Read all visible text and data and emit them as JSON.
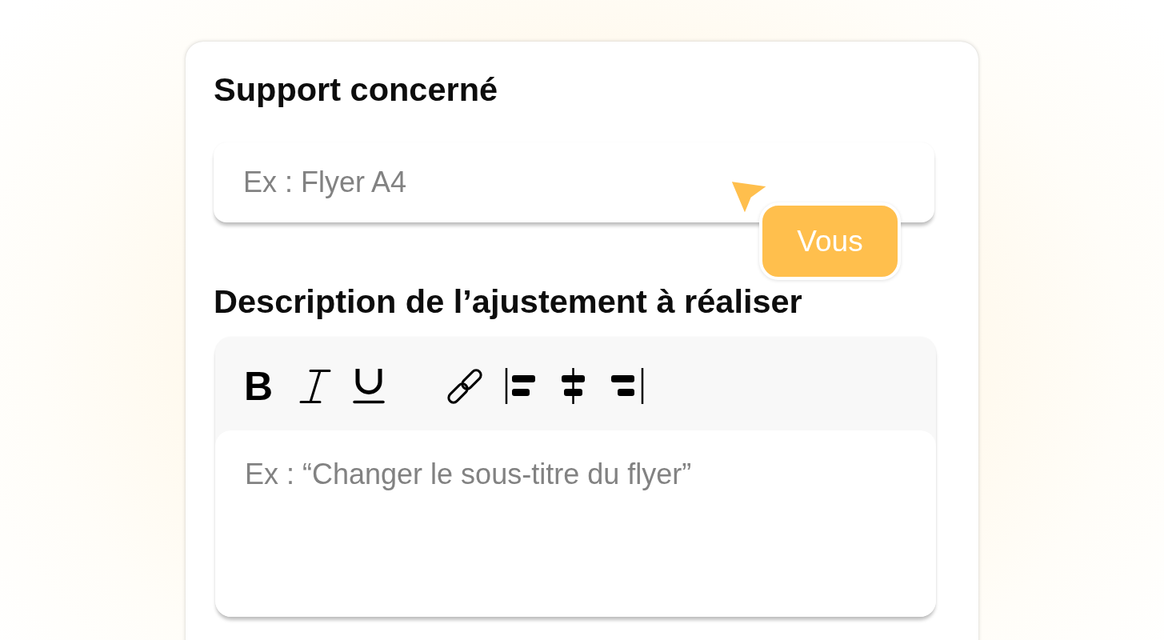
{
  "support_field": {
    "label": "Support concerné",
    "placeholder": "Ex : Flyer A4"
  },
  "cursor": {
    "label": "Vous"
  },
  "description_field": {
    "label": "Description de l’ajustement à réaliser",
    "toolbar": {
      "bold_label": "B"
    },
    "placeholder": "Ex : “Changer le sous-titre du flyer”"
  }
}
